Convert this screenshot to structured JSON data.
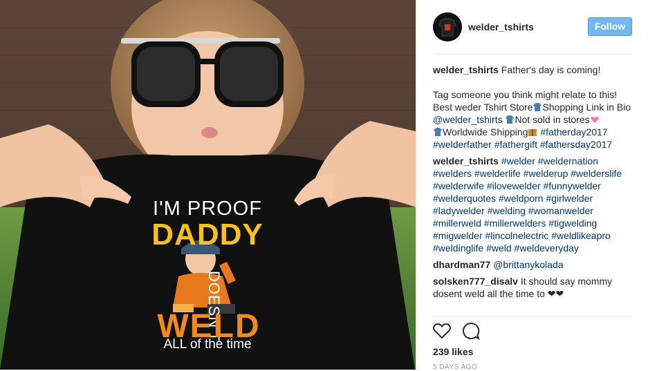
{
  "post": {
    "username": "welder_tshirts",
    "follow_label": "Follow",
    "likes": "239 likes",
    "time_ago": "5 DAYS AGO",
    "shirt_text": {
      "line1": "I'M PROOF",
      "line2": "DADDY",
      "line3": "DOESN'T",
      "line4": "WELD",
      "line5": "ALL of the time"
    },
    "caption": {
      "username": "welder_tshirts",
      "line1": "Father's day is coming!",
      "line2": "Tag someone you think might relate to this!",
      "seg1": "Best weder Tshirt Store",
      "seg2": "Shopping Link in Bio",
      "mention": "@welder_tshirts",
      "seg3": "Not sold in stores",
      "seg4": "Worldwide Shipping",
      "tags": [
        "#fatherday2017",
        "#welderfather",
        "#fathergift",
        "#fathersday2017"
      ]
    },
    "hashtag_comment": {
      "username": "welder_tshirts",
      "tags": [
        "#welder",
        "#weldernation",
        "#welders",
        "#welderlife",
        "#welderup",
        "#welderslife",
        "#welderwife",
        "#ilovewelder",
        "#funnywelder",
        "#welderquotes",
        "#weldporn",
        "#girlwelder",
        "#ladywelder",
        "#welding",
        "#womanwelder",
        "#millerweld",
        "#millerwelders",
        "#tigwelding",
        "#migwelder",
        "#lincolnelectric",
        "#weldlikeapro",
        "#weldinglife",
        "#weld",
        "#weldeveryday"
      ]
    },
    "comments": [
      {
        "username": "dhardman77",
        "mention": "@brittanykolada",
        "text": ""
      },
      {
        "username": "solsken777_disalv",
        "mention": "",
        "text": "It should say mommy dosent weld all the time to ❤❤"
      }
    ],
    "icons": {
      "like": "heart-icon",
      "comment": "comment-bubble-icon"
    }
  }
}
